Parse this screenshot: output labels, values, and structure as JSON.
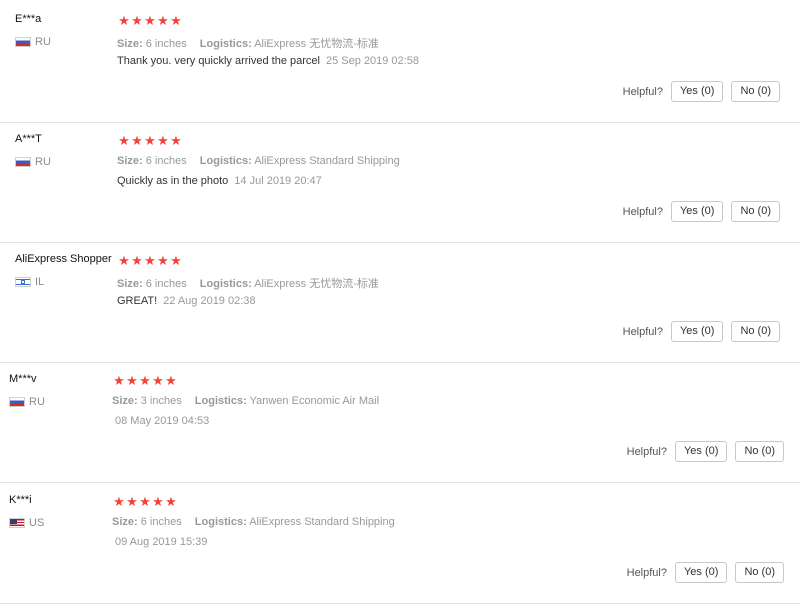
{
  "helpful_label": "Helpful?",
  "reviews": [
    {
      "user": "E***a",
      "country": "RU",
      "flag": "ru",
      "stars": 5,
      "size_label": "Size:",
      "size": "6 inches",
      "logistics_label": "Logistics:",
      "logistics": "AliExpress 无忧物流-标准",
      "text": "Thank you. very quickly arrived the parcel",
      "date": "25 Sep 2019 02:58",
      "yes": "Yes (0)",
      "no": "No (0)"
    },
    {
      "user": "A***T",
      "country": "RU",
      "flag": "ru",
      "stars": 5,
      "size_label": "Size:",
      "size": "6 inches",
      "logistics_label": "Logistics:",
      "logistics": "AliExpress Standard Shipping",
      "text": "Quickly as in the photo",
      "date": "14 Jul 2019 20:47",
      "yes": "Yes (0)",
      "no": "No (0)"
    },
    {
      "user": "AliExpress Shopper",
      "country": "IL",
      "flag": "il",
      "stars": 5,
      "size_label": "Size:",
      "size": "6 inches",
      "logistics_label": "Logistics:",
      "logistics": "AliExpress 无忧物流-标准",
      "text": "GREAT!",
      "date": "22 Aug 2019 02:38",
      "yes": "Yes (0)",
      "no": "No (0)"
    },
    {
      "user": "M***v",
      "country": "RU",
      "flag": "ru",
      "stars": 5,
      "size_label": "Size:",
      "size": "3 inches",
      "logistics_label": "Logistics:",
      "logistics": "Yanwen Economic Air Mail",
      "text": "",
      "date": "08 May 2019 04:53",
      "yes": "Yes (0)",
      "no": "No (0)"
    },
    {
      "user": "K***i",
      "country": "US",
      "flag": "us",
      "stars": 5,
      "size_label": "Size:",
      "size": "6 inches",
      "logistics_label": "Logistics:",
      "logistics": "AliExpress Standard Shipping",
      "text": "",
      "date": "09 Aug 2019 15:39",
      "yes": "Yes (0)",
      "no": "No (0)"
    }
  ]
}
